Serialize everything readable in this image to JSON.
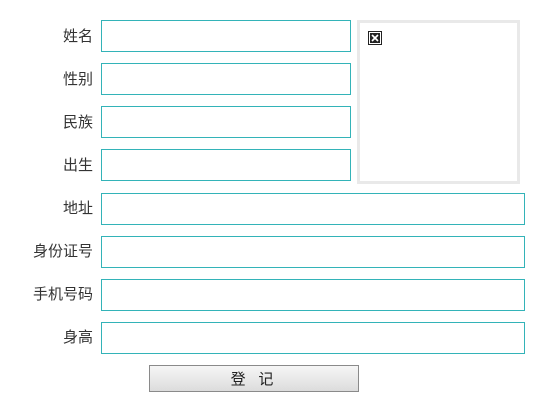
{
  "form": {
    "fields": [
      {
        "label": "姓名",
        "value": ""
      },
      {
        "label": "性别",
        "value": ""
      },
      {
        "label": "民族",
        "value": ""
      },
      {
        "label": "出生",
        "value": ""
      },
      {
        "label": "地址",
        "value": ""
      },
      {
        "label": "身份证号",
        "value": ""
      },
      {
        "label": "手机号码",
        "value": ""
      },
      {
        "label": "身高",
        "value": ""
      }
    ],
    "photo_icon": "broken-image-icon",
    "submit_label": "登 记"
  },
  "colors": {
    "input_border": "#33b3b8",
    "photo_border": "#e9e9e9",
    "label_text": "#333333"
  }
}
